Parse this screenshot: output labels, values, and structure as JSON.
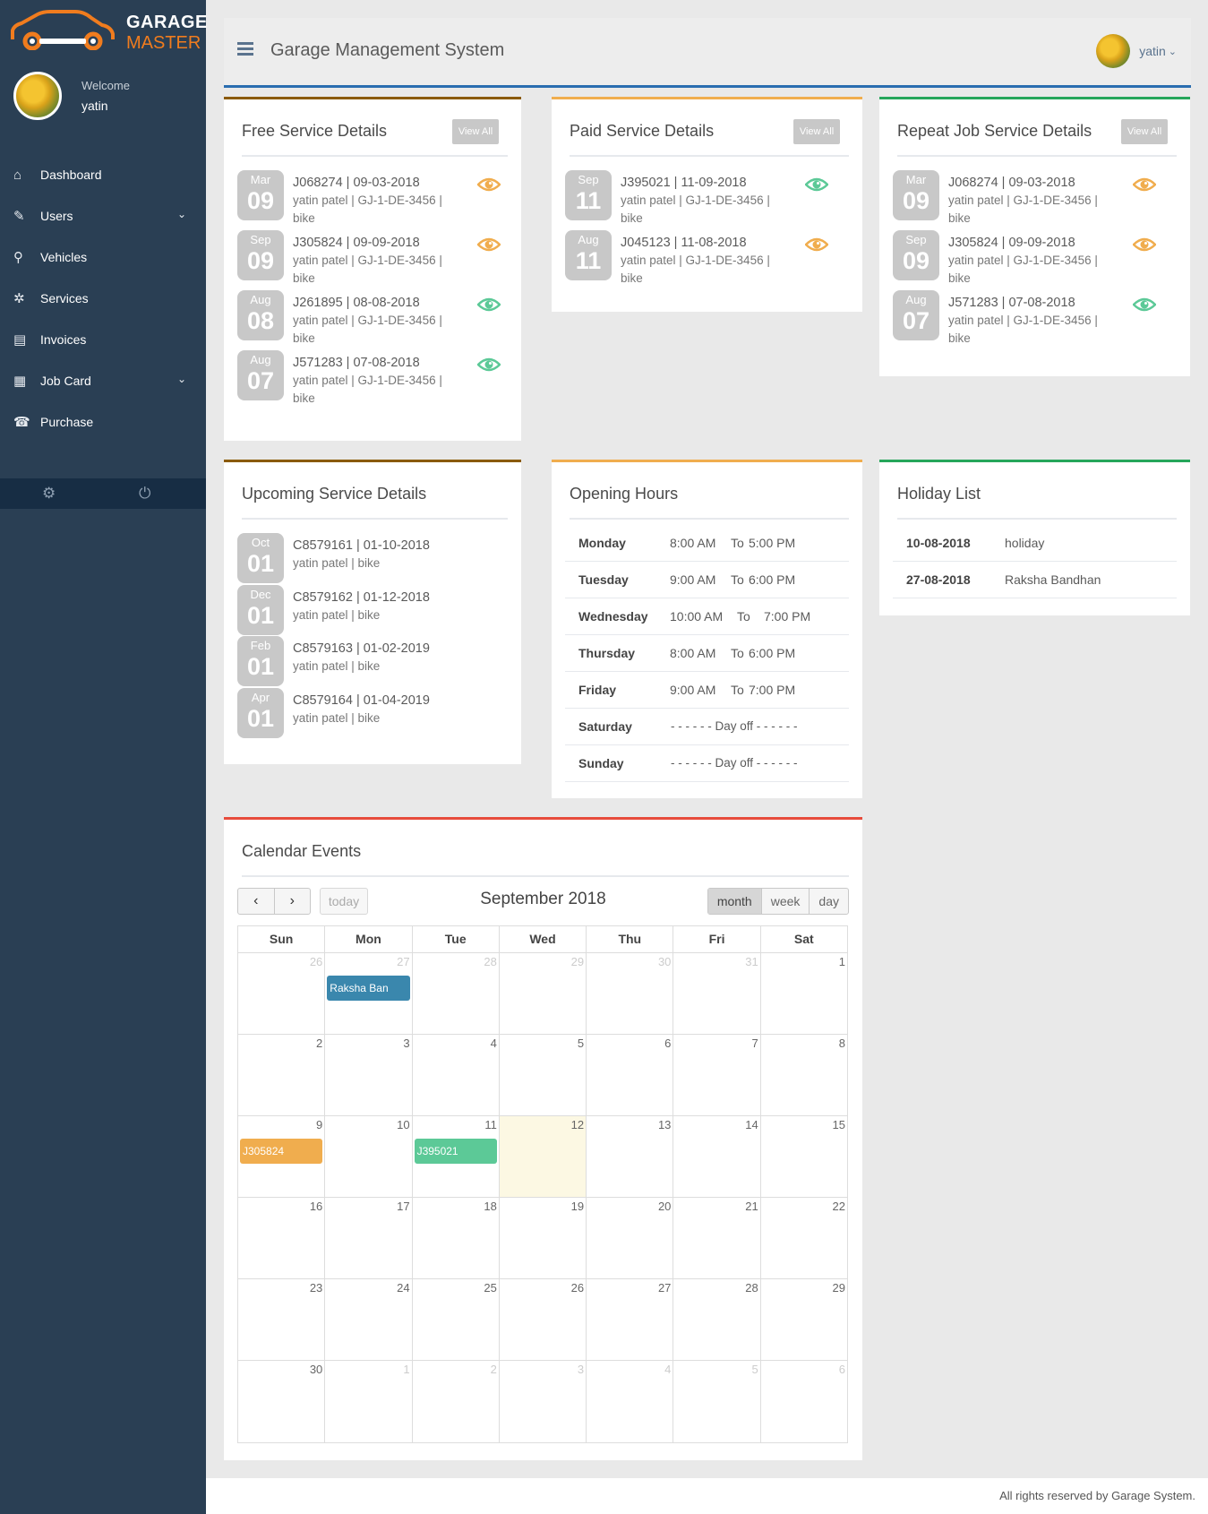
{
  "brand": {
    "line1": "GARAGE",
    "line2": "MASTER",
    "accent": "#f07c1e"
  },
  "profile": {
    "welcome": "Welcome",
    "name": "yatin"
  },
  "menu": [
    {
      "label": "Dashboard",
      "icon": "home-icon",
      "glyph": "⌂"
    },
    {
      "label": "Users",
      "icon": "edit-icon",
      "glyph": "✎",
      "submenu": true
    },
    {
      "label": "Vehicles",
      "icon": "motorcycle-icon",
      "glyph": "⚲"
    },
    {
      "label": "Services",
      "icon": "puzzle-icon",
      "glyph": "✲"
    },
    {
      "label": "Invoices",
      "icon": "file-icon",
      "glyph": "▤"
    },
    {
      "label": "Job Card",
      "icon": "table-icon",
      "glyph": "▦",
      "submenu": true
    },
    {
      "label": "Purchase",
      "icon": "cart-icon",
      "glyph": "☎"
    }
  ],
  "topbar": {
    "title": "Garage Management System",
    "user": "yatin"
  },
  "free_service": {
    "title": "Free Service Details",
    "view_all": "View All",
    "items": [
      {
        "mon": "Mar",
        "day": "09",
        "line1": "J068274 | 09-03-2018",
        "line2": "yatin patel | GJ-1-DE-3456 | bike",
        "eye_color": "#f0ad4e"
      },
      {
        "mon": "Sep",
        "day": "09",
        "line1": "J305824 | 09-09-2018",
        "line2": "yatin patel | GJ-1-DE-3456 | bike",
        "eye_color": "#f0ad4e"
      },
      {
        "mon": "Aug",
        "day": "08",
        "line1": "J261895 | 08-08-2018",
        "line2": "yatin patel | GJ-1-DE-3456 | bike",
        "eye_color": "#5cc997"
      },
      {
        "mon": "Aug",
        "day": "07",
        "line1": "J571283 | 07-08-2018",
        "line2": "yatin patel | GJ-1-DE-3456 | bike",
        "eye_color": "#5cc997"
      }
    ]
  },
  "paid_service": {
    "title": "Paid Service Details",
    "view_all": "View All",
    "items": [
      {
        "mon": "Sep",
        "day": "11",
        "line1": "J395021 | 11-09-2018",
        "line2": "yatin patel | GJ-1-DE-3456 | bike",
        "eye_color": "#5cc997"
      },
      {
        "mon": "Aug",
        "day": "11",
        "line1": "J045123 | 11-08-2018",
        "line2": "yatin patel | GJ-1-DE-3456 | bike",
        "eye_color": "#f0ad4e"
      }
    ]
  },
  "repeat_service": {
    "title": "Repeat Job Service Details",
    "view_all": "View All",
    "items": [
      {
        "mon": "Mar",
        "day": "09",
        "line1": "J068274 | 09-03-2018",
        "line2": "yatin patel | GJ-1-DE-3456 | bike",
        "eye_color": "#f0ad4e"
      },
      {
        "mon": "Sep",
        "day": "09",
        "line1": "J305824 | 09-09-2018",
        "line2": "yatin patel | GJ-1-DE-3456 | bike",
        "eye_color": "#f0ad4e"
      },
      {
        "mon": "Aug",
        "day": "07",
        "line1": "J571283 | 07-08-2018",
        "line2": "yatin patel | GJ-1-DE-3456 | bike",
        "eye_color": "#5cc997"
      }
    ]
  },
  "upcoming": {
    "title": "Upcoming Service Details",
    "items": [
      {
        "mon": "Oct",
        "day": "01",
        "line1": "C8579161 | 01-10-2018",
        "line2": "yatin patel | bike"
      },
      {
        "mon": "Dec",
        "day": "01",
        "line1": "C8579162 | 01-12-2018",
        "line2": "yatin patel | bike"
      },
      {
        "mon": "Feb",
        "day": "01",
        "line1": "C8579163 | 01-02-2019",
        "line2": "yatin patel | bike"
      },
      {
        "mon": "Apr",
        "day": "01",
        "line1": "C8579164 | 01-04-2019",
        "line2": "yatin patel | bike"
      }
    ]
  },
  "opening_hours": {
    "title": "Opening Hours",
    "rows": [
      {
        "day": "Monday",
        "from": "8:00 AM",
        "to_label": "To",
        "to": "5:00 PM"
      },
      {
        "day": "Tuesday",
        "from": "9:00 AM",
        "to_label": "To",
        "to": "6:00 PM"
      },
      {
        "day": "Wednesday",
        "from": "10:00 AM",
        "to_label": "To",
        "to": "7:00 PM"
      },
      {
        "day": "Thursday",
        "from": "8:00 AM",
        "to_label": "To",
        "to": "6:00 PM"
      },
      {
        "day": "Friday",
        "from": "9:00 AM",
        "to_label": "To",
        "to": "7:00 PM"
      },
      {
        "day": "Saturday",
        "off": "- - - - - - Day off - - - - - -"
      },
      {
        "day": "Sunday",
        "off": "- - - - - - Day off - - - - - -"
      }
    ]
  },
  "holidays": {
    "title": "Holiday List",
    "rows": [
      {
        "date": "10-08-2018",
        "name": "holiday"
      },
      {
        "date": "27-08-2018",
        "name": "Raksha Bandhan"
      }
    ]
  },
  "calendar": {
    "title": "Calendar Events",
    "month_label": "September 2018",
    "today_label": "today",
    "views": [
      "month",
      "week",
      "day"
    ],
    "weekdays": [
      "Sun",
      "Mon",
      "Tue",
      "Wed",
      "Thu",
      "Fri",
      "Sat"
    ],
    "weeks": [
      [
        {
          "n": "26",
          "other": true
        },
        {
          "n": "27",
          "other": true,
          "event": "Raksha Ban",
          "color": "#3a87ad"
        },
        {
          "n": "28",
          "other": true
        },
        {
          "n": "29",
          "other": true
        },
        {
          "n": "30",
          "other": true
        },
        {
          "n": "31",
          "other": true
        },
        {
          "n": "1"
        }
      ],
      [
        {
          "n": "2"
        },
        {
          "n": "3"
        },
        {
          "n": "4"
        },
        {
          "n": "5"
        },
        {
          "n": "6"
        },
        {
          "n": "7"
        },
        {
          "n": "8"
        }
      ],
      [
        {
          "n": "9",
          "event": "J305824",
          "color": "#f0ad4e"
        },
        {
          "n": "10"
        },
        {
          "n": "11",
          "event": "J395021",
          "color": "#5cc997"
        },
        {
          "n": "12",
          "today": true
        },
        {
          "n": "13"
        },
        {
          "n": "14"
        },
        {
          "n": "15"
        }
      ],
      [
        {
          "n": "16"
        },
        {
          "n": "17"
        },
        {
          "n": "18"
        },
        {
          "n": "19"
        },
        {
          "n": "20"
        },
        {
          "n": "21"
        },
        {
          "n": "22"
        }
      ],
      [
        {
          "n": "23"
        },
        {
          "n": "24"
        },
        {
          "n": "25"
        },
        {
          "n": "26"
        },
        {
          "n": "27"
        },
        {
          "n": "28"
        },
        {
          "n": "29"
        }
      ],
      [
        {
          "n": "30"
        },
        {
          "n": "1",
          "other": true
        },
        {
          "n": "2",
          "other": true
        },
        {
          "n": "3",
          "other": true
        },
        {
          "n": "4",
          "other": true
        },
        {
          "n": "5",
          "other": true
        },
        {
          "n": "6",
          "other": true
        }
      ]
    ]
  },
  "footer": {
    "text": "All rights reserved by Garage System."
  }
}
